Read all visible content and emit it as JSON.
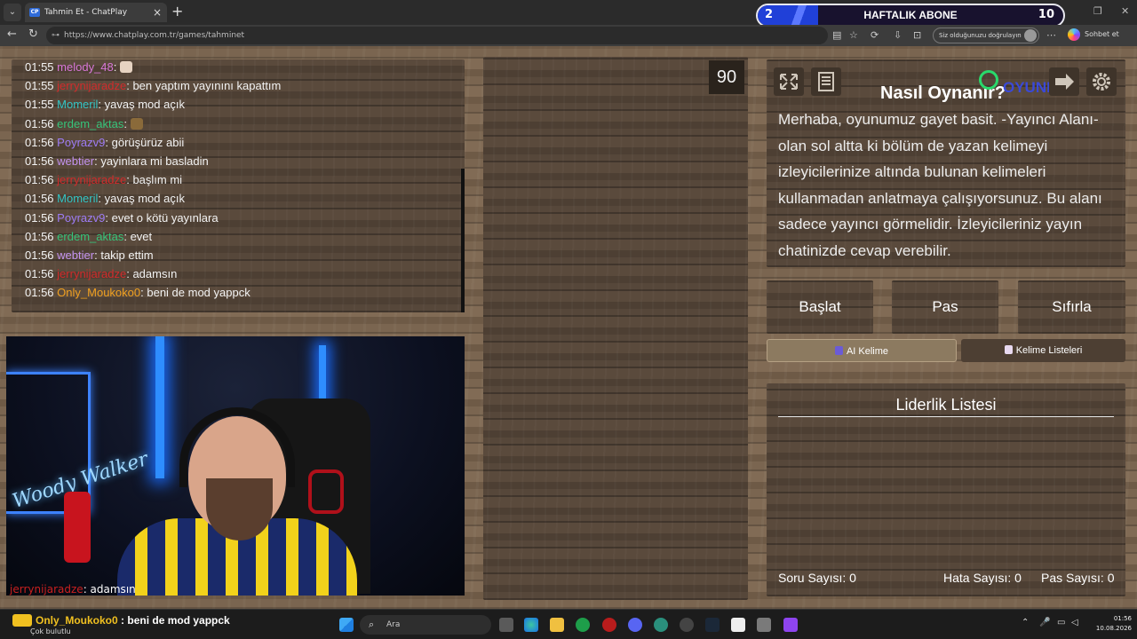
{
  "browser": {
    "tab_title": "Tahmin Et - ChatPlay",
    "tab_favicon": "CP",
    "url": "https://www.chatplay.com.tr/games/tahminet",
    "verify_label": "Siz olduğunuzu doğrulayın",
    "chat_label": "Sohbet et"
  },
  "sub_goal": {
    "current": "2",
    "title": "HAFTALIK ABONE",
    "goal": "10",
    "progress_fraction": 0.2,
    "accent": "#2040d8"
  },
  "chat": {
    "lines": [
      {
        "time": "01:55",
        "user": "melody_48",
        "color": "#d877d8",
        "sep": ": ",
        "msg": ""
      },
      {
        "time": "01:55",
        "user": "jerrynijaradze",
        "color": "#d12b2b",
        "sep": ": ",
        "msg": "ben yaptım yayınını kapattım"
      },
      {
        "time": "01:55",
        "user": "Momeril",
        "color": "#33c6c6",
        "sep": ": ",
        "msg": "yavaş mod açık"
      },
      {
        "time": "01:56",
        "user": "erdem_aktas",
        "color": "#36c47a",
        "sep": ": ",
        "msg": ""
      },
      {
        "time": "01:56",
        "user": "Poyrazv9",
        "color": "#9d7cf5",
        "sep": ": ",
        "msg": "görüşürüz abii"
      },
      {
        "time": "01:56",
        "user": "webtier",
        "color": "#c393f0",
        "sep": ": ",
        "msg": "yayinlara mi basladin"
      },
      {
        "time": "01:56",
        "user": "jerrynijaradze",
        "color": "#d12b2b",
        "sep": ": ",
        "msg": "başlım mi"
      },
      {
        "time": "01:56",
        "user": "Momeril",
        "color": "#33c6c6",
        "sep": ": ",
        "msg": "yavaş mod açık"
      },
      {
        "time": "01:56",
        "user": "Poyrazv9",
        "color": "#9d7cf5",
        "sep": ": ",
        "msg": "evet o kötü yayınlara"
      },
      {
        "time": "01:56",
        "user": "erdem_aktas",
        "color": "#36c47a",
        "sep": ": ",
        "msg": "evet"
      },
      {
        "time": "01:56",
        "user": "webtier",
        "color": "#c393f0",
        "sep": ": ",
        "msg": "takip ettim"
      },
      {
        "time": "01:56",
        "user": "jerrynijaradze",
        "color": "#d12b2b",
        "sep": ": ",
        "msg": "adamsın"
      },
      {
        "time": "01:56",
        "user": "Only_Moukoko0",
        "color": "#f0a020",
        "sep": ": ",
        "msg": "beni de mod yappck"
      }
    ]
  },
  "camera": {
    "neon_sign": "Woody Walker",
    "caption_user": "jerrynijaradze",
    "caption_sep": ": ",
    "caption_msg": "adamsın"
  },
  "game": {
    "timer": "90",
    "howto_title": "Nasıl Oynanır?",
    "logo_text": "OYUNEKS",
    "howto_text": "Merhaba, oyunumuz gayet basit. -Yayıncı Alanı- olan sol altta ki bölüm de yazan kelimeyi izleyicilerinize altında bulunan kelimeleri kullanmadan anlatmaya çalışıyorsunuz. Bu alanı sadece yayıncı görmelidir. İzleyicileriniz yayın chatinizde cevap verebilir.",
    "buttons": {
      "start": "Başlat",
      "pass": "Pas",
      "reset": "Sıfırla"
    },
    "tabs": {
      "ai": "AI Kelime",
      "lists": "Kelime Listeleri"
    },
    "leaderboard_title": "Liderlik Listesi",
    "stats": {
      "questions": "Soru Sayısı: 0",
      "errors": "Hata Sayısı: 0",
      "passes": "Pas Sayısı: 0"
    }
  },
  "taskbar": {
    "notif_user": "Only_Moukoko0",
    "notif_sep": " : ",
    "notif_msg": "beni de mod yappck",
    "notif_sub": "Çok bulutlu",
    "search_placeholder": "Ara",
    "time": "01:56",
    "date": "10.08.2026"
  }
}
